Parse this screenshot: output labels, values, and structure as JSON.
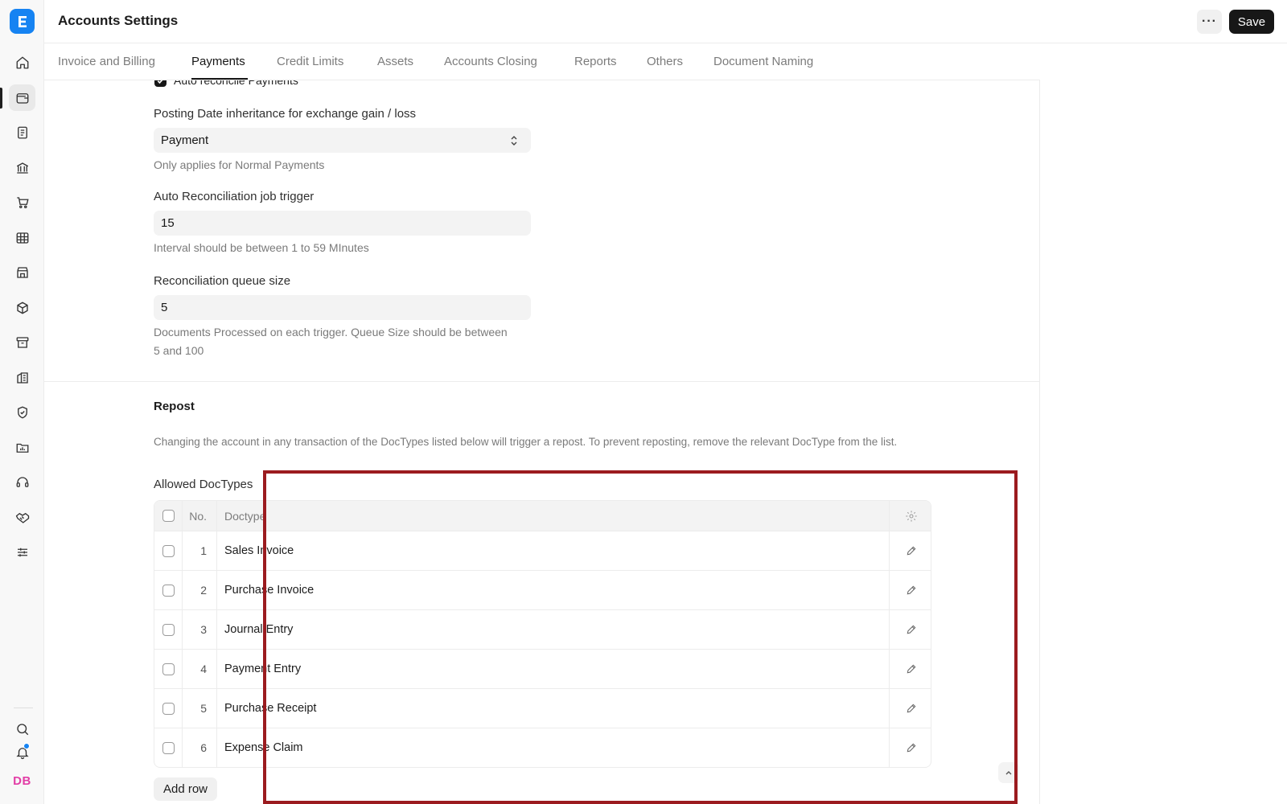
{
  "app": {
    "title": "Accounts Settings",
    "save_label": "Save",
    "more_icon": "more-horizontal-icon",
    "avatar_initials": "DB"
  },
  "sidebar": {
    "items": [
      {
        "icon": "home-icon"
      },
      {
        "icon": "wallet-icon",
        "active": true
      },
      {
        "icon": "document-icon"
      },
      {
        "icon": "bank-icon"
      },
      {
        "icon": "cart-icon"
      },
      {
        "icon": "table-icon"
      },
      {
        "icon": "store-icon"
      },
      {
        "icon": "package-icon"
      },
      {
        "icon": "archive-icon"
      },
      {
        "icon": "building-icon"
      },
      {
        "icon": "shield-icon"
      },
      {
        "icon": "folder-icon"
      },
      {
        "icon": "headset-icon"
      },
      {
        "icon": "handshake-icon"
      },
      {
        "icon": "sliders-icon"
      }
    ],
    "bottom": [
      {
        "icon": "search-icon"
      },
      {
        "icon": "bell-icon"
      }
    ]
  },
  "tabs": [
    {
      "label": "Invoice and Billing"
    },
    {
      "label": "Payments",
      "active": true
    },
    {
      "label": "Credit Limits"
    },
    {
      "label": "Assets"
    },
    {
      "label": "Accounts Closing"
    },
    {
      "label": "Reports"
    },
    {
      "label": "Others"
    },
    {
      "label": "Document Naming"
    }
  ],
  "payments": {
    "auto_reconcile_label": "Auto reconcile Payments",
    "auto_reconcile_checked": true,
    "posting_date_label": "Posting Date inheritance for exchange gain / loss",
    "posting_date_value": "Payment",
    "posting_date_help": "Only applies for Normal Payments",
    "job_trigger_label": "Auto Reconciliation job trigger",
    "job_trigger_value": "15",
    "job_trigger_help": "Interval should be between 1 to 59 MInutes",
    "queue_size_label": "Reconciliation queue size",
    "queue_size_value": "5",
    "queue_size_help": "Documents Processed on each trigger. Queue Size should be between 5 and 100"
  },
  "repost": {
    "title": "Repost",
    "description": "Changing the account in any transaction of the DocTypes listed below will trigger a repost. To prevent reposting, remove the relevant DocType from the list.",
    "table_label": "Allowed DocTypes",
    "columns": {
      "no": "No.",
      "doctype": "Doctype"
    },
    "rows": [
      {
        "no": "1",
        "doctype": "Sales Invoice"
      },
      {
        "no": "2",
        "doctype": "Purchase Invoice"
      },
      {
        "no": "3",
        "doctype": "Journal Entry"
      },
      {
        "no": "4",
        "doctype": "Payment Entry"
      },
      {
        "no": "5",
        "doctype": "Purchase Receipt"
      },
      {
        "no": "6",
        "doctype": "Expense Claim"
      }
    ],
    "add_row_label": "Add row"
  },
  "colors": {
    "accent": "#1683f2",
    "primary_button": "#171717",
    "highlight_box": "#9b1b1f",
    "avatar_text": "#e23da6"
  }
}
